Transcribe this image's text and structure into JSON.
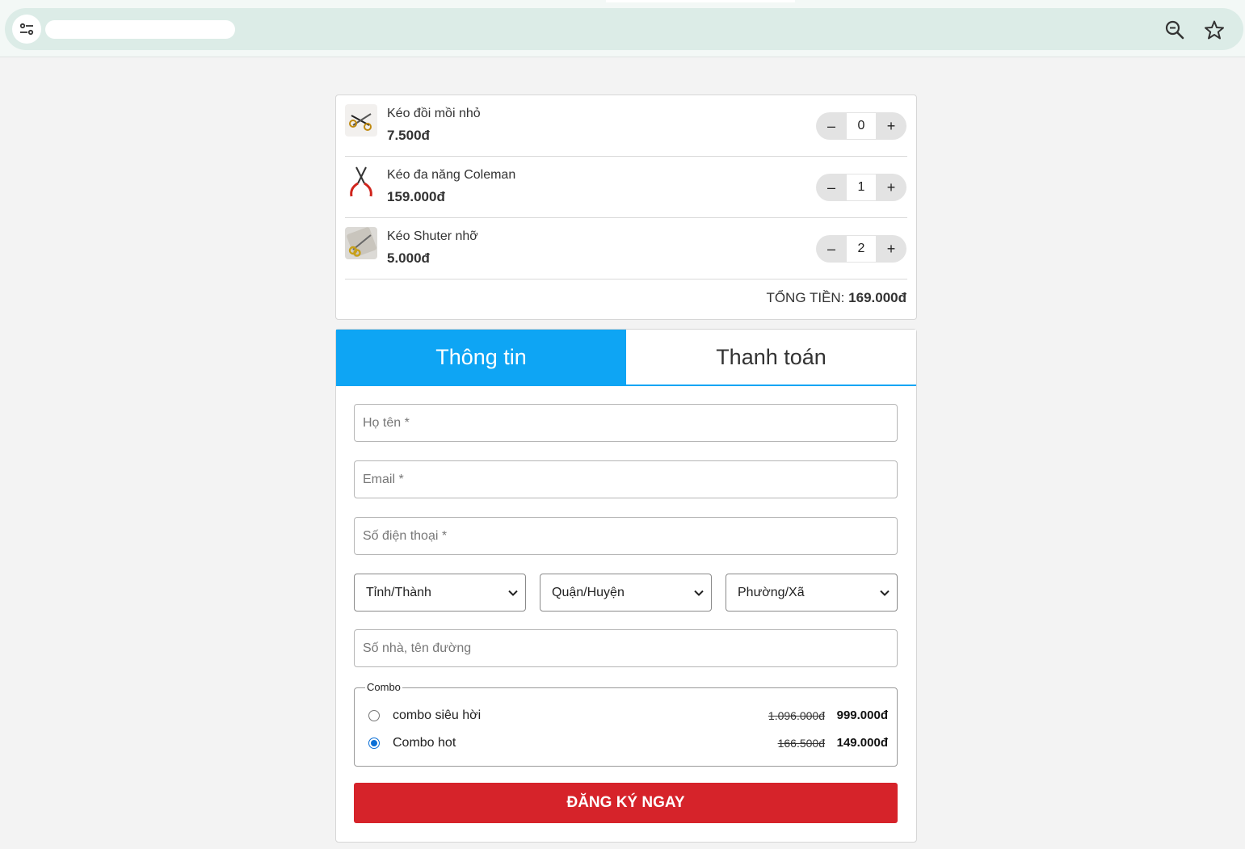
{
  "browser": {
    "site_info_icon": "tune-icon",
    "zoom_icon": "zoom-out-icon",
    "bookmark_icon": "star-icon"
  },
  "cart": {
    "items": [
      {
        "name": "Kéo đồi mồi nhỏ",
        "price": "7.500đ",
        "quantity": "0",
        "minus": "–",
        "plus": "+"
      },
      {
        "name": "Kéo đa năng Coleman",
        "price": "159.000đ",
        "quantity": "1",
        "minus": "–",
        "plus": "+"
      },
      {
        "name": "Kéo Shuter nhỡ",
        "price": "5.000đ",
        "quantity": "2",
        "minus": "–",
        "plus": "+"
      }
    ],
    "total_label": "TỔNG TIỀN:",
    "total_value": "169.000đ"
  },
  "tabs": [
    {
      "label": "Thông tin",
      "active": true
    },
    {
      "label": "Thanh toán",
      "active": false
    }
  ],
  "form": {
    "name_placeholder": "Họ tên *",
    "email_placeholder": "Email *",
    "phone_placeholder": "Số điện thoại *",
    "province": "Tỉnh/Thành",
    "district": "Quận/Huyện",
    "ward": "Phường/Xã",
    "address_placeholder": "Số nhà, tên đường",
    "combo_legend": "Combo",
    "combos": [
      {
        "label": "combo siêu hời",
        "old_price": "1.096.000đ",
        "new_price": "999.000đ",
        "selected": false
      },
      {
        "label": "Combo hot",
        "old_price": "166.500đ",
        "new_price": "149.000đ",
        "selected": true
      }
    ],
    "submit_label": "ĐĂNG KÝ NGAY"
  },
  "colors": {
    "accent": "#0ea5f4",
    "submit": "#d6232a",
    "radio_checked": "#0b6fd6"
  }
}
